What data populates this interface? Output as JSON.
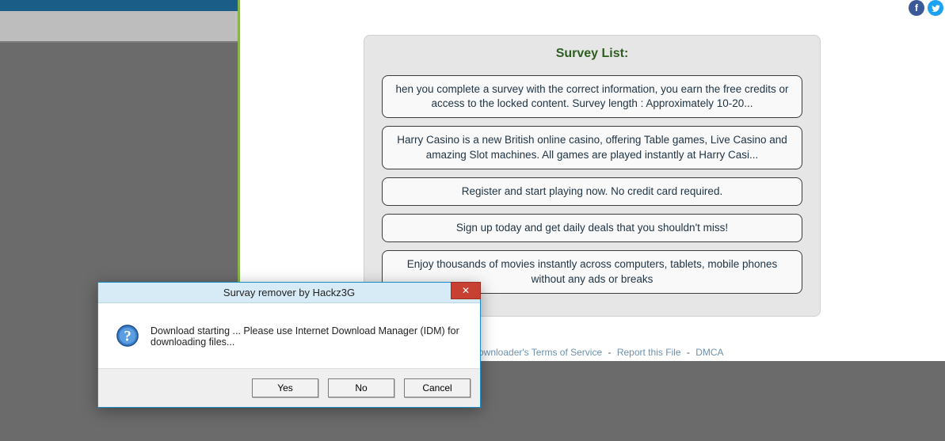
{
  "survey": {
    "title": "Survey List:",
    "items": [
      "hen you complete a survey with the correct information, you earn the free credits or access to the locked content. Survey length : Approximately 10-20...",
      "Harry Casino is a new British online casino, offering Table games, Live Casino and amazing Slot machines. All games are played instantly at Harry Casi...",
      "Register and start playing now. No credit card required.",
      "Sign up today and get daily deals that you shouldn't miss!",
      "Enjoy thousands of movies instantly across computers, tablets, mobile phones without any ads or breaks"
    ]
  },
  "footer": {
    "tos": "ownloader's Terms of Service",
    "report": "Report this File",
    "dmca": "DMCA",
    "sep": "-"
  },
  "social": {
    "fb": "f",
    "tw": "t"
  },
  "dialog": {
    "title": "Survay remover by Hackz3G",
    "message": "Download starting ... Please use Internet Download Manager (IDM) for downloading files...",
    "yes": "Yes",
    "no": "No",
    "cancel": "Cancel",
    "close": "✕"
  }
}
